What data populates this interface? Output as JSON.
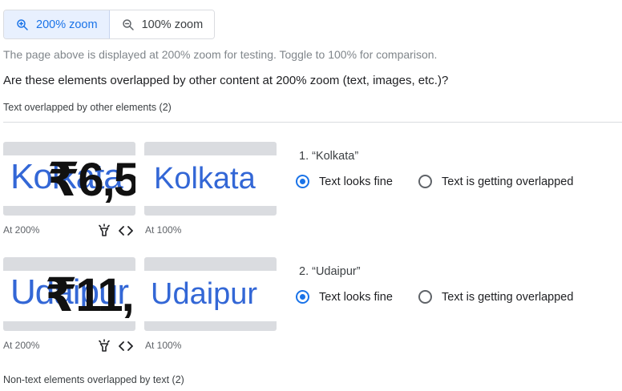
{
  "zoom_toggle": {
    "zoom_200_label": "200% zoom",
    "zoom_100_label": "100% zoom",
    "active": "200% zoom"
  },
  "info_text": "The page above is displayed at 200% zoom for testing. Toggle to 100% for comparison.",
  "question": "Are these elements overlapped by other content at 200% zoom (text, images, etc.)?",
  "sections": {
    "text_overlapped": "Text overlapped by other elements (2)",
    "non_text_overlapped": "Non-text elements overlapped by text  (2)"
  },
  "items": [
    {
      "title": "1. “Kolkata”",
      "thumb_200_word": "Kolkata",
      "thumb_200_overlay": "₹6,5",
      "thumb_100_word": "Kolkata",
      "caption_200": "At 200%",
      "caption_100": "At 100%",
      "options": [
        {
          "label": "Text looks fine",
          "checked": true
        },
        {
          "label": "Text is getting overlapped",
          "checked": false
        }
      ]
    },
    {
      "title": "2. “Udaipur”",
      "thumb_200_word": "Udaipur",
      "thumb_200_overlay": "₹11,",
      "thumb_100_word": "Udaipur",
      "caption_200": "At 200%",
      "caption_100": "At 100%",
      "options": [
        {
          "label": "Text looks fine",
          "checked": true
        },
        {
          "label": "Text is getting overlapped",
          "checked": false
        }
      ]
    }
  ],
  "icons": {
    "zoom_in": "zoom-in-icon",
    "zoom_out": "zoom-out-icon",
    "highlight": "flashlight-icon",
    "code": "code-icon"
  },
  "colors": {
    "accent": "#1a73e8",
    "active_bg": "#e8f0fe",
    "thumb_text": "#3367d6"
  }
}
